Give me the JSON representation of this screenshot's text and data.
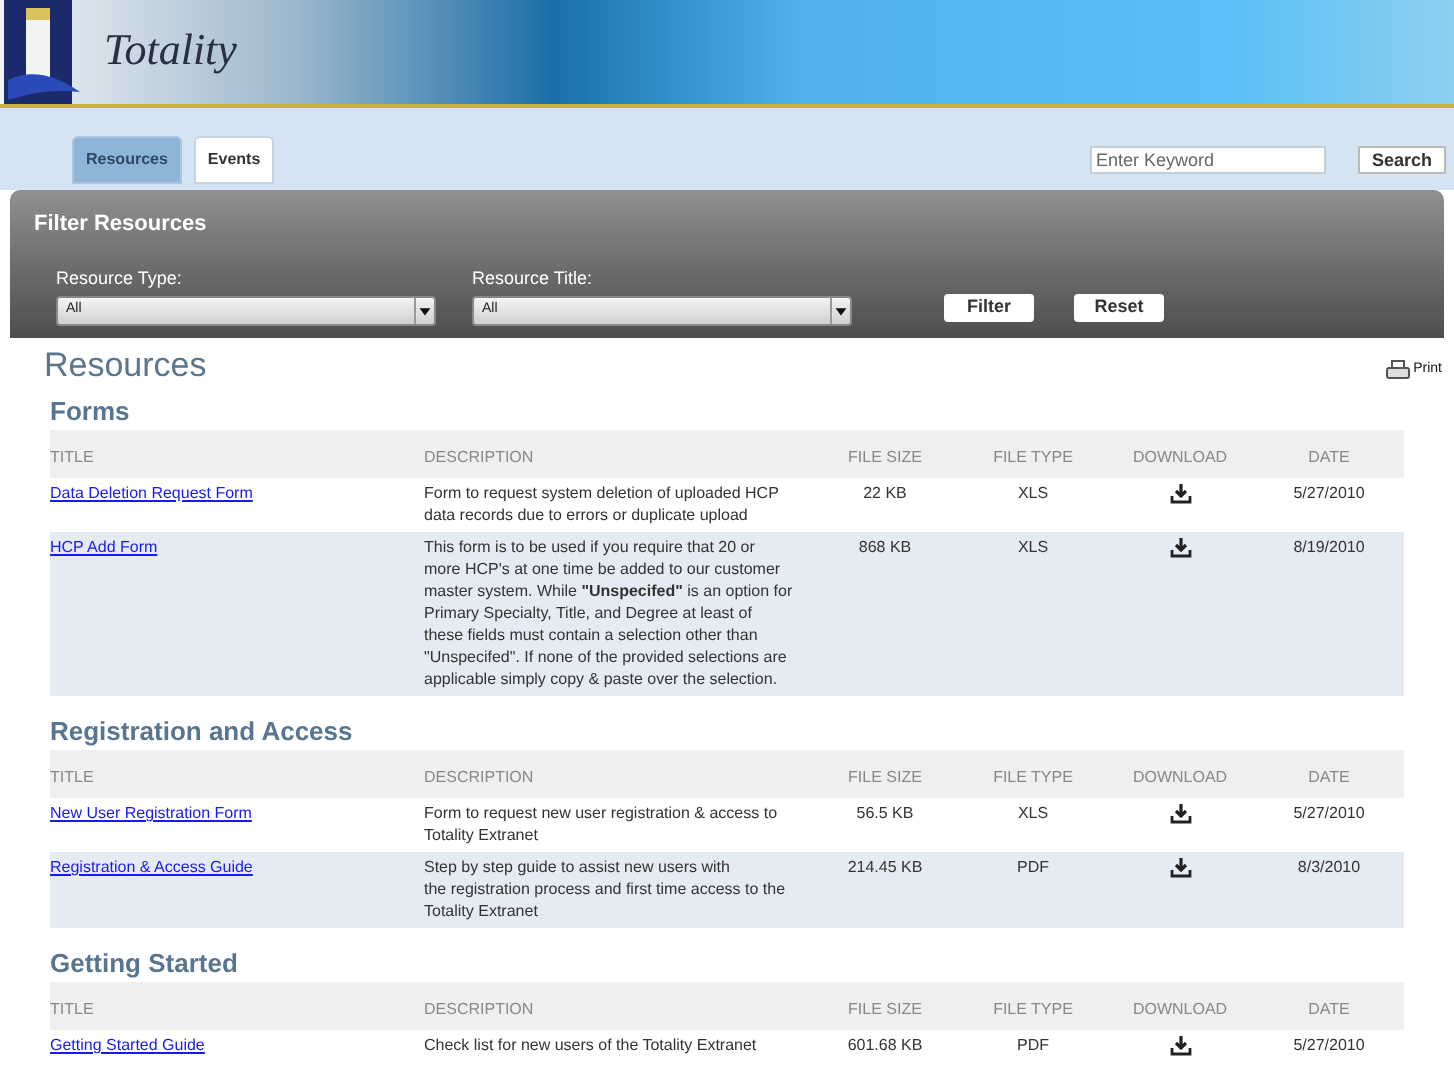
{
  "header": {
    "logo_text": "Totality"
  },
  "tabs": [
    {
      "label": "Resources",
      "selected": true
    },
    {
      "label": "Events",
      "selected": false
    }
  ],
  "search": {
    "placeholder": "Enter Keyword",
    "button": "Search"
  },
  "filter": {
    "title": "Filter Resources",
    "fields": [
      {
        "label": "Resource Type:",
        "value": "All"
      },
      {
        "label": "Resource Title:",
        "value": "All"
      }
    ],
    "buttons": [
      "Filter",
      "Reset"
    ]
  },
  "page_title": "Resources",
  "print_label": "Print",
  "sections": [
    {
      "title": "Forms",
      "columns": [
        "TITLE",
        "DESCRIPTION",
        "FILE SIZE",
        "FILE TYPE",
        "DOWNLOAD",
        "DATE"
      ],
      "rows": [
        {
          "title": "Data Deletion Request Form",
          "description": "Form to request system deletion of uploaded HCP data records due to errors or duplicate upload",
          "size": "22 KB",
          "type": "XLS",
          "date": "5/27/2010"
        },
        {
          "title": "HCP Add Form",
          "description": "This form is to be used if you require that 20 or more HCP's at one time be added to our customer master system. While **\"Unspecifed\"** is an option for Primary Specialty, Title, and Degree at least of these fields must contain a selection other than \"Unspecifed\". If none of the provided selections are applicable simply copy & paste over the selection.",
          "size": "868 KB",
          "type": "XLS",
          "date": "8/19/2010"
        }
      ]
    },
    {
      "title": "Registration and Access",
      "columns": [
        "TITLE",
        "DESCRIPTION",
        "FILE SIZE",
        "FILE TYPE",
        "DOWNLOAD",
        "DATE"
      ],
      "rows": [
        {
          "title": "New User Registration Form",
          "description": "Form to request new user registration & access to Totality Extranet",
          "size": "56.5 KB",
          "type": "XLS",
          "date": "5/27/2010"
        },
        {
          "title": "Registration & Access Guide",
          "description": "Step by step guide to assist new users with\nthe registration process and first time access to the Totality Extranet",
          "size": "214.45 KB",
          "type": "PDF",
          "date": "8/3/2010"
        }
      ]
    },
    {
      "title": "Getting Started",
      "columns": [
        "TITLE",
        "DESCRIPTION",
        "FILE SIZE",
        "FILE TYPE",
        "DOWNLOAD",
        "DATE"
      ],
      "rows": [
        {
          "title": "Getting Started Guide",
          "description": "Check list for new users of the Totality Extranet",
          "size": "601.68 KB",
          "type": "PDF",
          "date": "5/27/2010"
        }
      ]
    }
  ]
}
